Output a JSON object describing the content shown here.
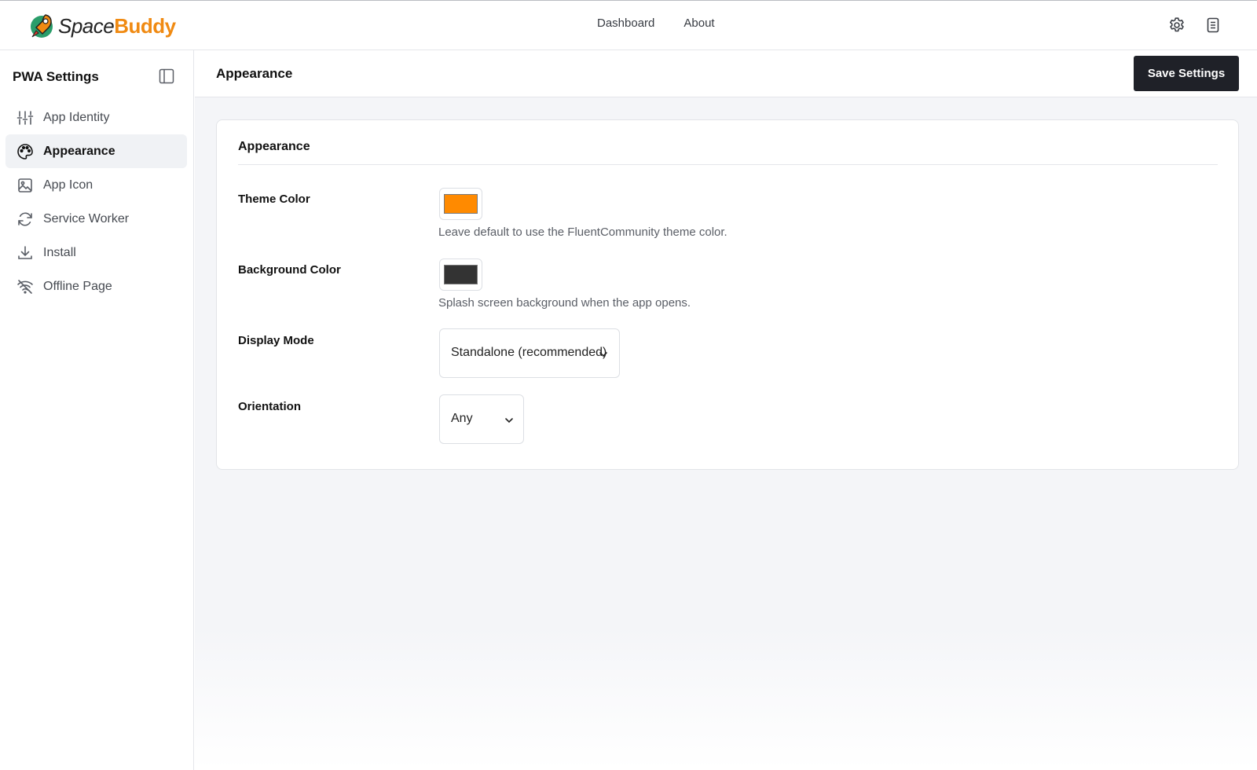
{
  "brand": {
    "name_part1": "Space",
    "name_part2": "Buddy",
    "accent": "#f08a12"
  },
  "topnav": {
    "items": [
      {
        "label": "Dashboard"
      },
      {
        "label": "About"
      }
    ]
  },
  "top_icons": [
    "gear-icon",
    "document-icon"
  ],
  "sidebar": {
    "title": "PWA Settings",
    "toggle_icon": "panel-toggle-icon",
    "items": [
      {
        "label": "App Identity",
        "icon": "sliders-icon",
        "active": false
      },
      {
        "label": "Appearance",
        "icon": "palette-icon",
        "active": true
      },
      {
        "label": "App Icon",
        "icon": "image-icon",
        "active": false
      },
      {
        "label": "Service Worker",
        "icon": "refresh-icon",
        "active": false
      },
      {
        "label": "Install",
        "icon": "download-icon",
        "active": false
      },
      {
        "label": "Offline Page",
        "icon": "wifi-off-icon",
        "active": false
      }
    ]
  },
  "header": {
    "title": "Appearance",
    "save_label": "Save Settings"
  },
  "card": {
    "title": "Appearance",
    "theme_color": {
      "label": "Theme Color",
      "value": "#ff8a00",
      "help": "Leave default to use the FluentCommunity theme color."
    },
    "background_color": {
      "label": "Background Color",
      "value": "#333333",
      "help": "Splash screen background when the app opens."
    },
    "display_mode": {
      "label": "Display Mode",
      "selected": "Standalone (recommended)"
    },
    "orientation": {
      "label": "Orientation",
      "selected": "Any"
    }
  }
}
